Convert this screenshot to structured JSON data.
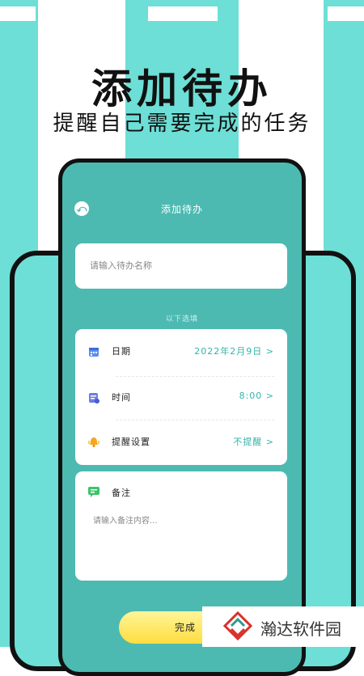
{
  "marketing": {
    "headline": "添加待办",
    "subheadline": "提醒自己需要完成的任务"
  },
  "screen": {
    "title": "添加待办",
    "back_icon": "back-arrow-icon",
    "name_placeholder": "请输入待办名称",
    "options_caption": "以下选填",
    "options": [
      {
        "icon": "calendar-icon",
        "label": "日期",
        "value": "2022年2月9日 >"
      },
      {
        "icon": "clock-card-icon",
        "label": "时间",
        "value": "8:00 >"
      },
      {
        "icon": "bell-icon",
        "label": "提醒设置",
        "value": "不提醒 >"
      }
    ],
    "notes": {
      "icon": "note-icon",
      "label": "备注",
      "placeholder": "请输入备注内容..."
    },
    "done_label": "完成"
  },
  "watermark": {
    "text": "瀚达软件园"
  },
  "colors": {
    "stripe": "#6ddfd6",
    "phone_bg": "#4dbab2",
    "accent_text": "#35b3a8",
    "button": "#ffdd3e"
  }
}
